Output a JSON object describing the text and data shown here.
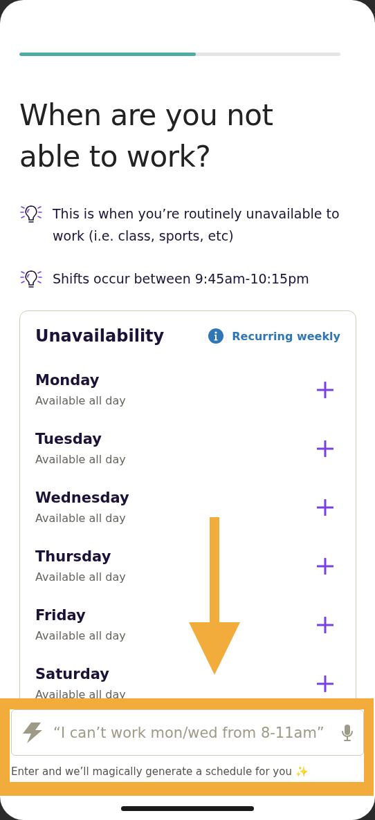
{
  "progress": {
    "level": 0.55
  },
  "title": "When are you not able to work?",
  "tips": [
    "This is when you’re routinely unavailable to work (i.e. class, sports, etc)",
    "Shifts occur between 9:45am-10:15pm"
  ],
  "card": {
    "title": "Unavailability",
    "note": "Recurring weekly",
    "days": [
      {
        "name": "Monday",
        "status": "Available all day"
      },
      {
        "name": "Tuesday",
        "status": "Available all day"
      },
      {
        "name": "Wednesday",
        "status": "Available all day"
      },
      {
        "name": "Thursday",
        "status": "Available all day"
      },
      {
        "name": "Friday",
        "status": "Available all day"
      },
      {
        "name": "Saturday",
        "status": "Available all day"
      }
    ]
  },
  "prompt": {
    "placeholder": "“I can’t work mon/wed from 8-11am”",
    "hint": "Enter and we’ll magically generate a schedule for you ✨"
  }
}
